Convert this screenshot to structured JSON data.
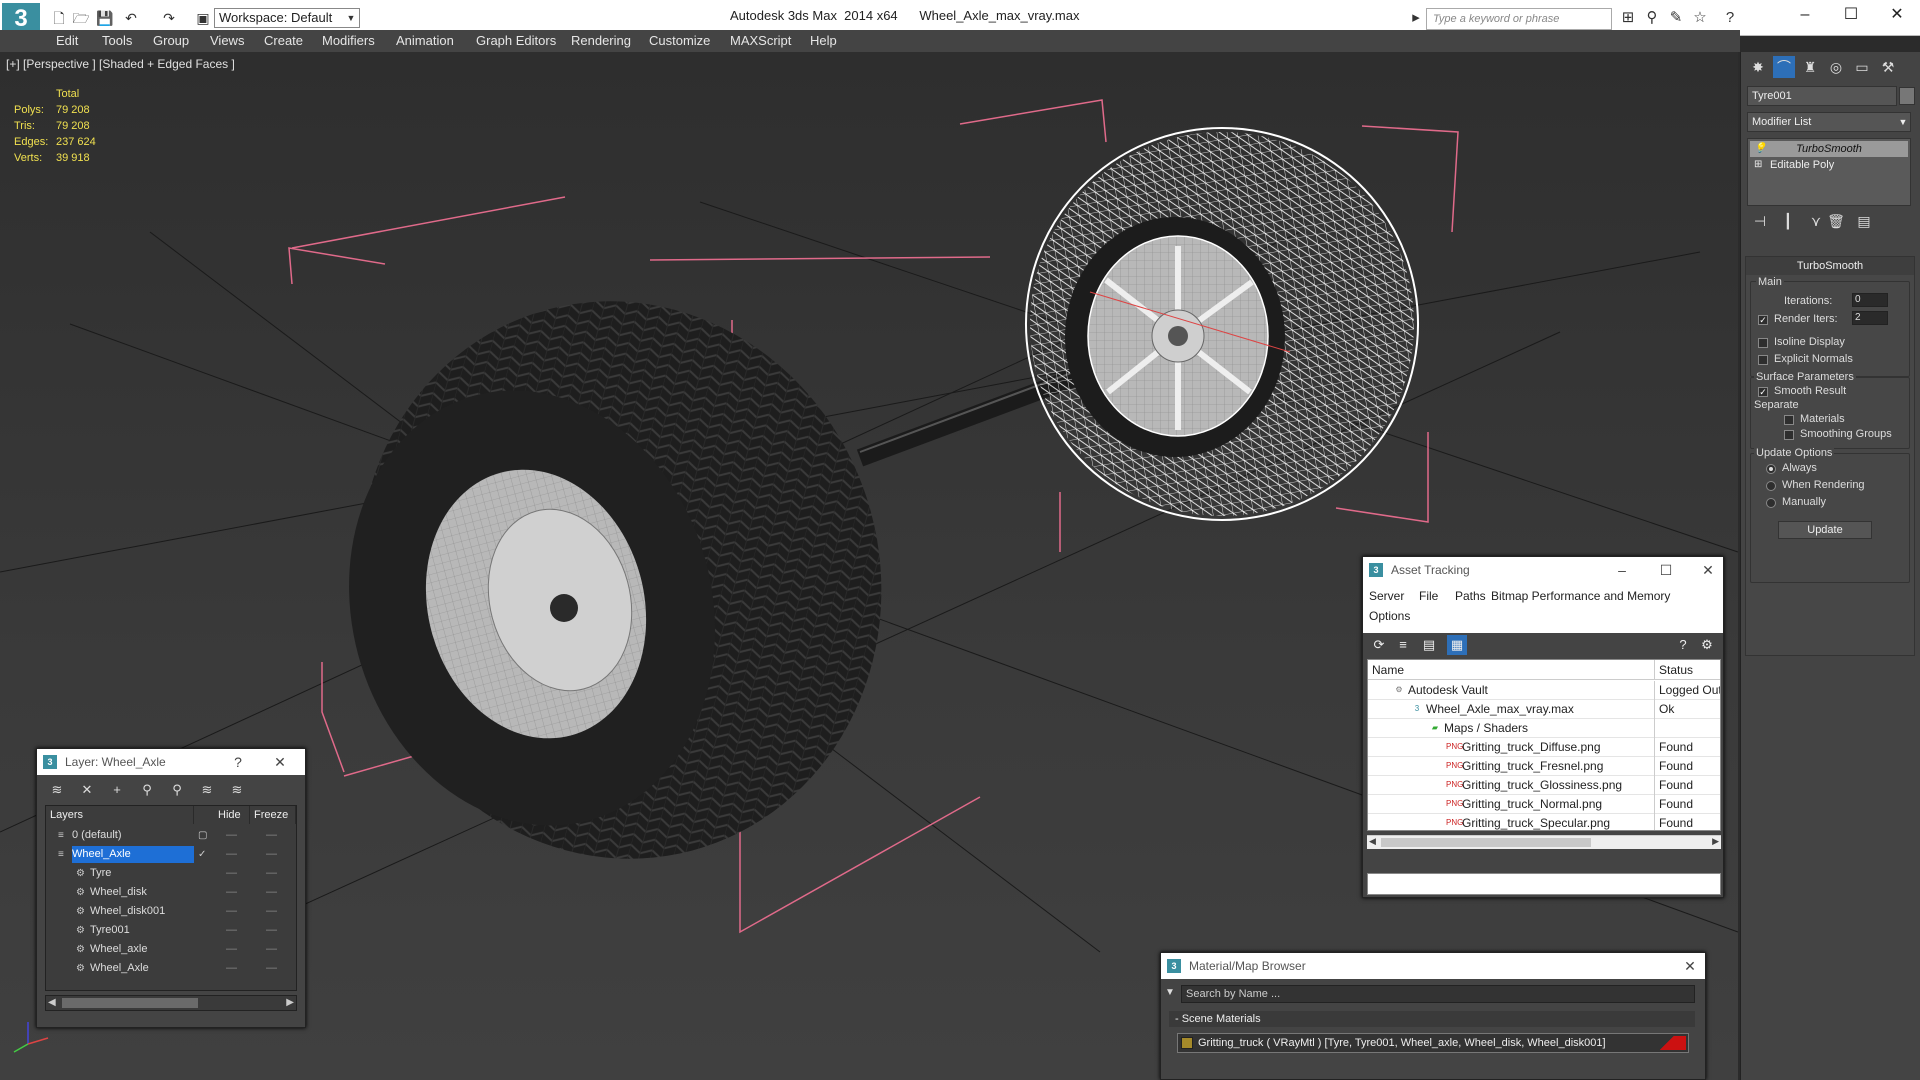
{
  "app": {
    "title": "Autodesk 3ds Max  2014 x64",
    "file": "Wheel_Axle_max_vray.max",
    "logo_char": "3",
    "workspace": "Workspace: Default",
    "search_placeholder": "Type a keyword or phrase",
    "window_controls": {
      "minimize": "–",
      "maximize": "☐",
      "close": "✕"
    }
  },
  "menu": [
    "Edit",
    "Tools",
    "Group",
    "Views",
    "Create",
    "Modifiers",
    "Animation",
    "Graph Editors",
    "Rendering",
    "Customize",
    "MAXScript",
    "Help"
  ],
  "viewport": {
    "label": "[+] [Perspective ] [Shaded + Edged Faces ]",
    "stats": {
      "header": "Total",
      "rows": [
        {
          "label": "Polys:",
          "value": "79 208"
        },
        {
          "label": "Tris:",
          "value": "79 208"
        },
        {
          "label": "Edges:",
          "value": "237 624"
        },
        {
          "label": "Verts:",
          "value": "39 918"
        }
      ]
    },
    "colors": {
      "bbox": "#e06a8a",
      "tyre": "#1e1e1e",
      "rim": "#bdbdbd",
      "wire": "#ffffff"
    }
  },
  "command_panel": {
    "object_name": "Tyre001",
    "modifier_list": "Modifier List",
    "stack": [
      "TurboSmooth",
      "Editable Poly"
    ],
    "turbosmooth": {
      "title": "TurboSmooth",
      "main": "Main",
      "iterations_label": "Iterations:",
      "iterations_value": "0",
      "render_iters_label": "Render Iters:",
      "render_iters_value": "2",
      "render_iters_checked": true,
      "isoline": "Isoline Display",
      "explicit": "Explicit Normals",
      "surface": "Surface Parameters",
      "smooth_result": "Smooth Result",
      "separate": "Separate",
      "materials": "Materials",
      "smoothing_groups": "Smoothing Groups",
      "update_options": "Update Options",
      "always": "Always",
      "when_rendering": "When Rendering",
      "manually": "Manually",
      "update_button": "Update"
    }
  },
  "layer_window": {
    "title": "Layer: Wheel_Axle",
    "help": "?",
    "close": "✕",
    "columns": [
      "Layers",
      "Hide",
      "Freeze"
    ],
    "rows": [
      {
        "name": "0 (default)",
        "indent": 1
      },
      {
        "name": "Wheel_Axle",
        "indent": 1,
        "selected": true
      },
      {
        "name": "Tyre",
        "indent": 2
      },
      {
        "name": "Wheel_disk",
        "indent": 2
      },
      {
        "name": "Wheel_disk001",
        "indent": 2
      },
      {
        "name": "Tyre001",
        "indent": 2
      },
      {
        "name": "Wheel_axle",
        "indent": 2
      },
      {
        "name": "Wheel_Axle",
        "indent": 2
      }
    ]
  },
  "asset_window": {
    "title": "Asset Tracking",
    "menu": [
      "Server",
      "File",
      "Paths",
      "Bitmap Performance and Memory",
      "Options"
    ],
    "columns": [
      "Name",
      "Status"
    ],
    "rows": [
      {
        "name": "Autodesk Vault",
        "status": "Logged Out ...",
        "indent": 1,
        "icon": "vault-icon"
      },
      {
        "name": "Wheel_Axle_max_vray.max",
        "status": "Ok",
        "indent": 2,
        "icon": "max-file-icon"
      },
      {
        "name": "Maps / Shaders",
        "status": "",
        "indent": 3,
        "icon": "maps-icon"
      },
      {
        "name": "Gritting_truck_Diffuse.png",
        "status": "Found",
        "indent": 4,
        "icon": "png-icon"
      },
      {
        "name": "Gritting_truck_Fresnel.png",
        "status": "Found",
        "indent": 4,
        "icon": "png-icon"
      },
      {
        "name": "Gritting_truck_Glossiness.png",
        "status": "Found",
        "indent": 4,
        "icon": "png-icon"
      },
      {
        "name": "Gritting_truck_Normal.png",
        "status": "Found",
        "indent": 4,
        "icon": "png-icon"
      },
      {
        "name": "Gritting_truck_Specular.png",
        "status": "Found",
        "indent": 4,
        "icon": "png-icon"
      }
    ]
  },
  "material_browser": {
    "title": "Material/Map Browser",
    "search_placeholder": "Search by Name ...",
    "section": "- Scene Materials",
    "item": "Gritting_truck  ( VRayMtl )  [Tyre, Tyre001, Wheel_axle, Wheel_disk, Wheel_disk001]"
  }
}
